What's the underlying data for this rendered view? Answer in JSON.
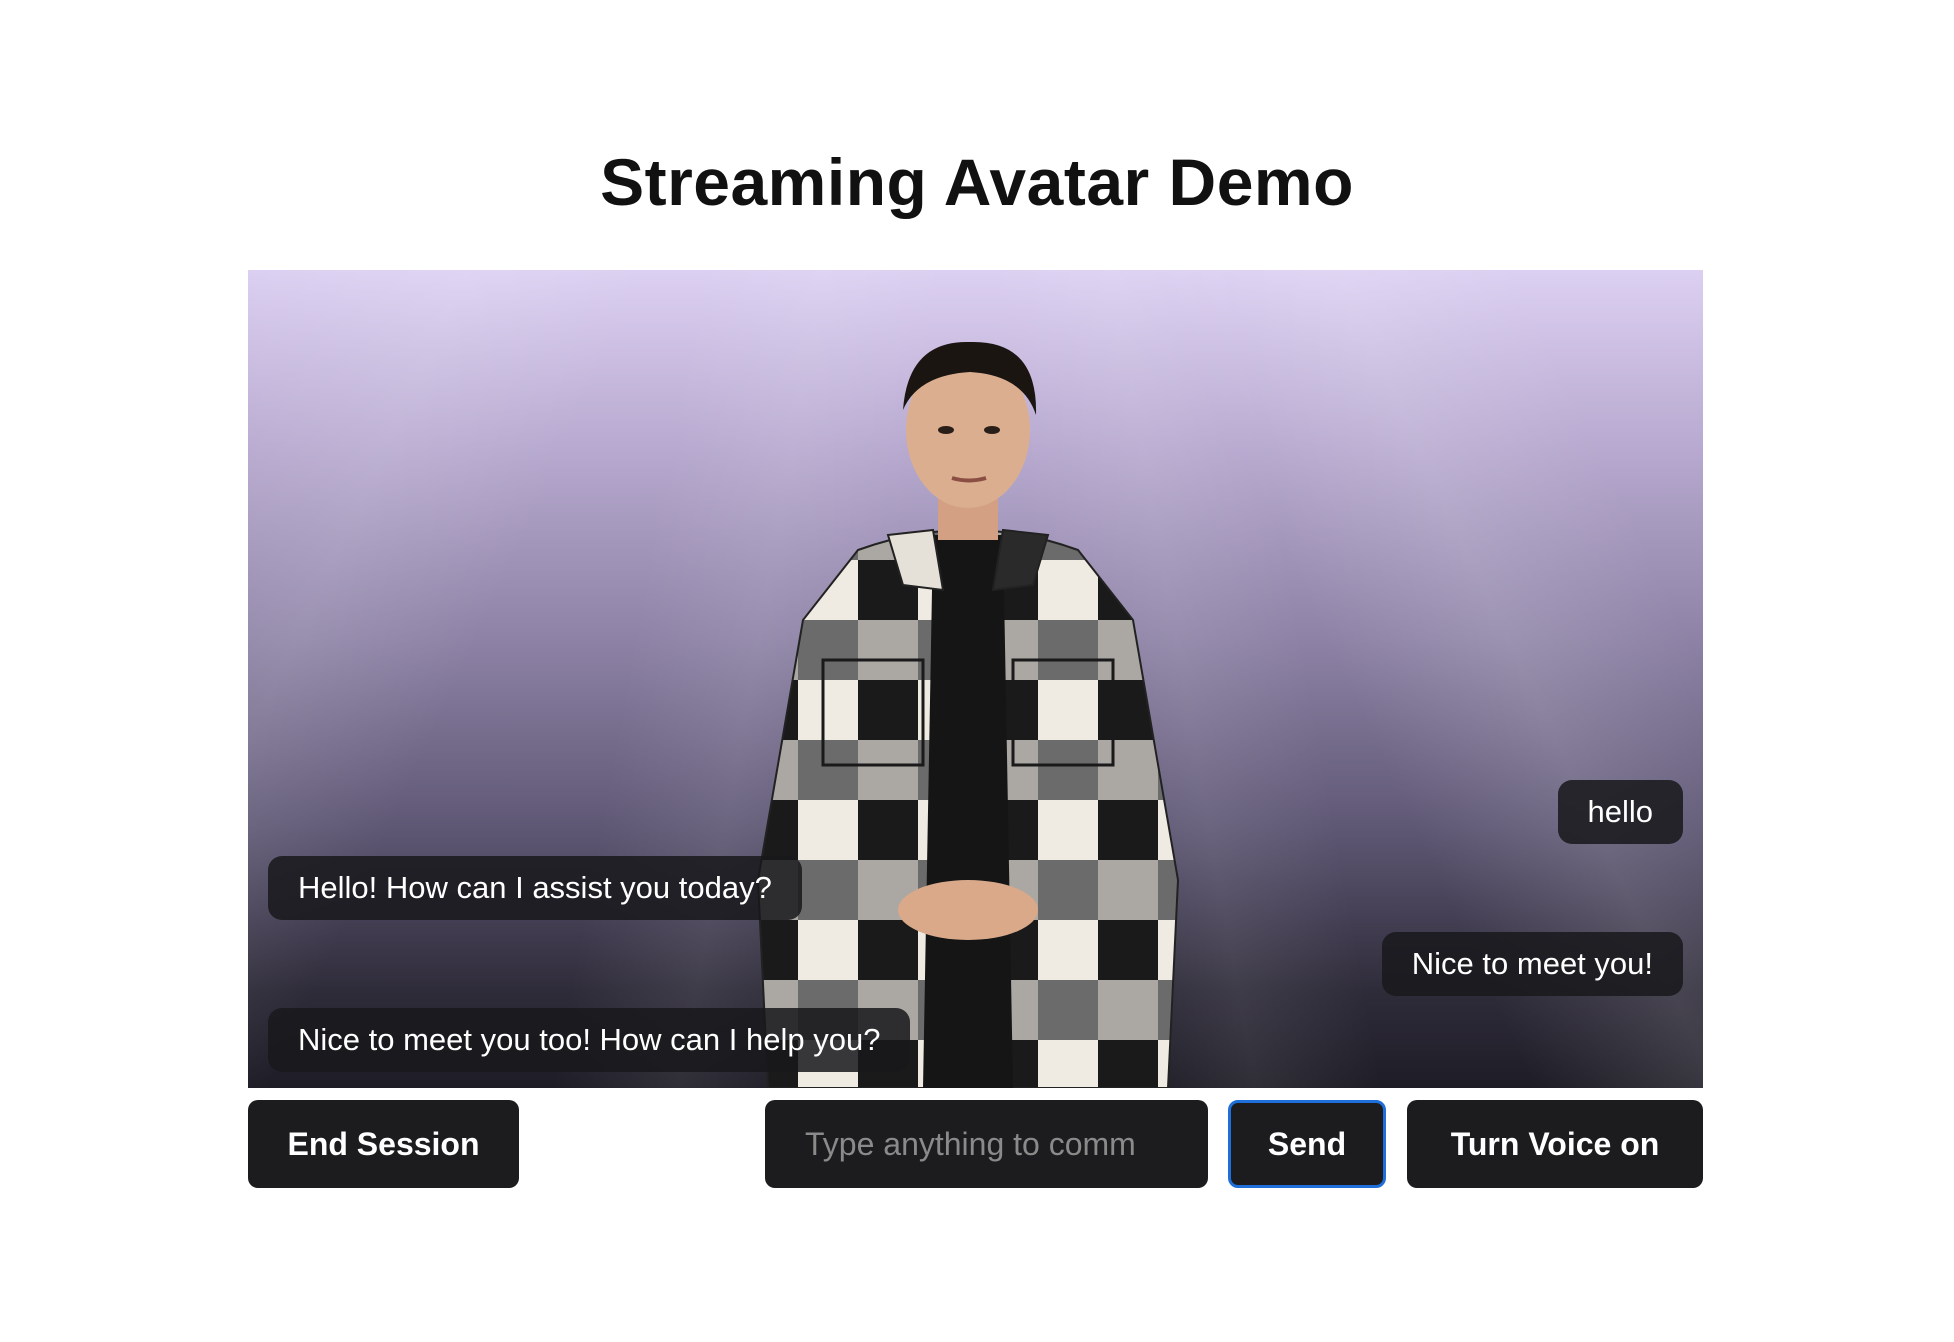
{
  "page": {
    "title": "Streaming Avatar Demo"
  },
  "conversation": {
    "messages": [
      {
        "role": "user",
        "text": "hello"
      },
      {
        "role": "assistant",
        "text": "Hello! How can I assist you today?"
      },
      {
        "role": "user",
        "text": "Nice to meet you!"
      },
      {
        "role": "assistant",
        "text": "Nice to meet you too! How can I help you?"
      }
    ]
  },
  "controls": {
    "end_session_label": "End Session",
    "input_placeholder": "Type anything to communicate with the avatar",
    "input_visible_text": "Type anything to comm",
    "send_label": "Send",
    "voice_label": "Turn Voice on"
  },
  "colors": {
    "button_bg": "#1c1c1e",
    "send_focus_border": "#1e6fd9",
    "bubble_bg": "#18181c",
    "stage_top": "#dcd0f2",
    "stage_bottom": "#1e1d26"
  },
  "icons": {
    "avatar": "avatar-video"
  }
}
